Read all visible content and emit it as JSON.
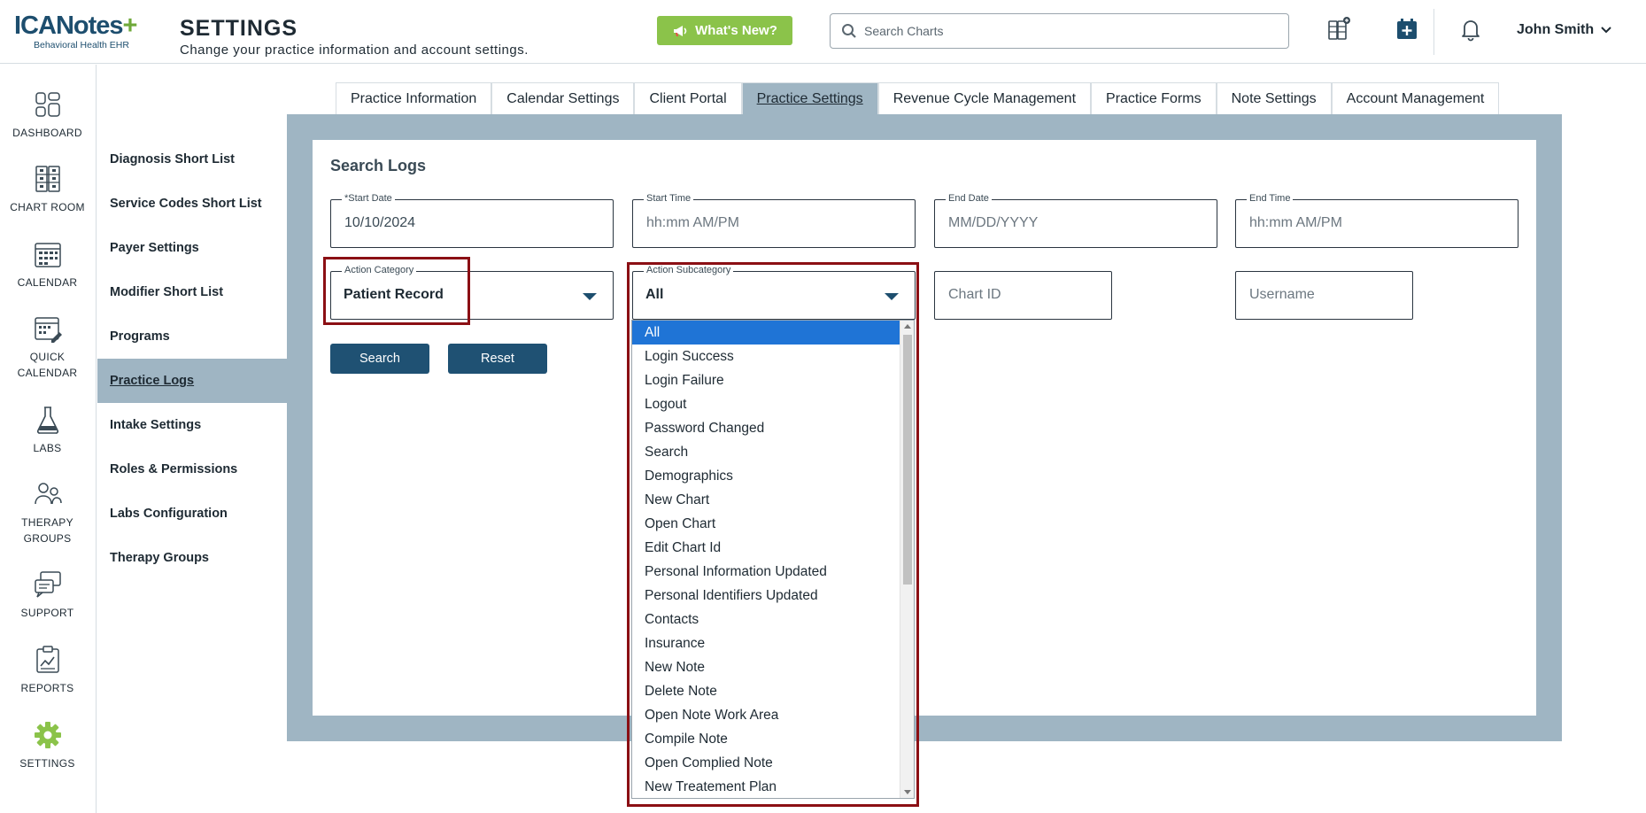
{
  "header": {
    "logo_main": "ICANotes",
    "logo_plus": "+",
    "logo_sub": "Behavioral Health EHR",
    "title": "SETTINGS",
    "subtitle": "Change your practice information and account settings.",
    "whats_new": "What's New?",
    "search_placeholder": "Search Charts",
    "user_name": "John Smith"
  },
  "leftnav": [
    {
      "label": "DASHBOARD",
      "icon": "dashboard-icon"
    },
    {
      "label": "CHART ROOM",
      "icon": "chart-room-icon"
    },
    {
      "label": "CALENDAR",
      "icon": "calendar-icon"
    },
    {
      "label": "QUICK CALENDAR",
      "icon": "quick-calendar-icon"
    },
    {
      "label": "LABS",
      "icon": "labs-flask-icon"
    },
    {
      "label": "THERAPY GROUPS",
      "icon": "therapy-groups-icon"
    },
    {
      "label": "SUPPORT",
      "icon": "support-chat-icon"
    },
    {
      "label": "REPORTS",
      "icon": "reports-icon"
    },
    {
      "label": "SETTINGS",
      "icon": "settings-gear-icon"
    }
  ],
  "submenu": [
    "Diagnosis Short List",
    "Service Codes Short List",
    "Payer Settings",
    "Modifier Short List",
    "Programs",
    "Practice Logs",
    "Intake Settings",
    "Roles & Permissions",
    "Labs Configuration",
    "Therapy Groups"
  ],
  "submenu_active": "Practice Logs",
  "tabs": [
    "Practice Information",
    "Calendar Settings",
    "Client Portal",
    "Practice Settings",
    "Revenue Cycle Management",
    "Practice Forms",
    "Note Settings",
    "Account Management"
  ],
  "tab_active": "Practice Settings",
  "form": {
    "section_title": "Search Logs",
    "start_date_label": "*Start Date",
    "start_date_value": "10/10/2024",
    "start_time_label": "Start Time",
    "start_time_placeholder": "hh:mm AM/PM",
    "end_date_label": "End Date",
    "end_date_placeholder": "MM/DD/YYYY",
    "end_time_label": "End Time",
    "end_time_placeholder": "hh:mm AM/PM",
    "action_category_label": "Action Category",
    "action_category_value": "Patient Record",
    "action_subcategory_label": "Action Subcategory",
    "action_subcategory_value": "All",
    "chart_id_placeholder": "Chart ID",
    "username_placeholder": "Username",
    "search_button": "Search",
    "reset_button": "Reset"
  },
  "dropdown_options": [
    "All",
    "Login Success",
    "Login Failure",
    "Logout",
    "Password Changed",
    "Search",
    "Demographics",
    "New Chart",
    "Open Chart",
    "Edit Chart Id",
    "Personal Information Updated",
    "Personal Identifiers Updated",
    "Contacts",
    "Insurance",
    "New Note",
    "Delete Note",
    "Open Note Work Area",
    "Compile Note",
    "Open Complied Note",
    "New Treatement Plan"
  ],
  "dropdown_selected": "All",
  "colors": {
    "brand_navy": "#1d4e6e",
    "brand_green": "#6fa93a",
    "whats_new_green": "#8bc34a",
    "panel_blue_gray": "#9fb5c3",
    "button_navy": "#1f5173",
    "highlight_red": "#8b0f14",
    "selected_blue": "#1f74d6"
  }
}
